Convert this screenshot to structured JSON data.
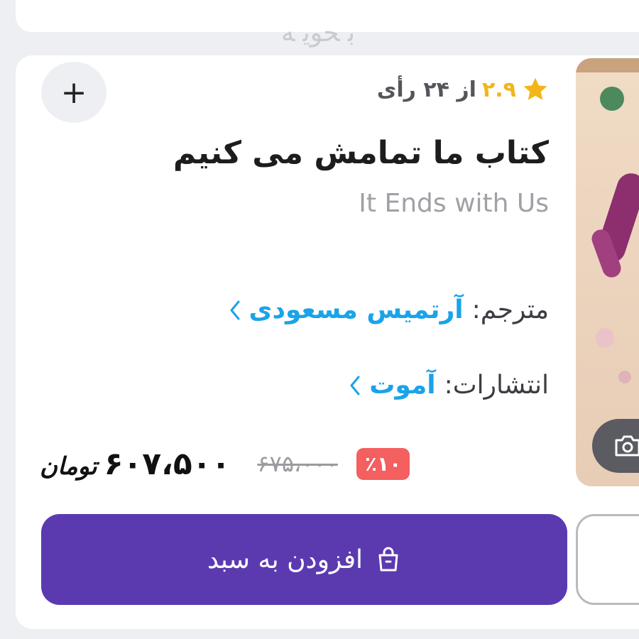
{
  "top_card": {
    "partial_text": "ﺑ ﺤﻮﯾ ﻪ"
  },
  "product": {
    "rating": {
      "score": "۲.۹",
      "votes_text": "از ۲۴ رأی"
    },
    "title": "کتاب ما تمامش می کنیم",
    "subtitle": "It Ends with Us",
    "translator": {
      "label": "مترجم:",
      "name": "آرتمیس مسعودی"
    },
    "publisher": {
      "label": "انتشارات:",
      "name": "آموت"
    },
    "price": {
      "discount": "٪۱۰",
      "old": "۶۷۵،۰۰۰",
      "final": "۶۰۷،۵۰۰",
      "unit": "تومان"
    },
    "add_button_symbol": "+",
    "cart_button_label": "افزودن به سبد"
  },
  "colors": {
    "accent_purple": "#5b3ab0",
    "link_blue": "#1aa3e8",
    "star_yellow": "#f2b619",
    "discount_red": "#f45f5f"
  },
  "icons": {
    "star": "star-icon",
    "chevron": "chevron-left-icon",
    "bag": "shopping-bag-icon",
    "camera": "camera-icon",
    "plus": "plus-icon"
  }
}
